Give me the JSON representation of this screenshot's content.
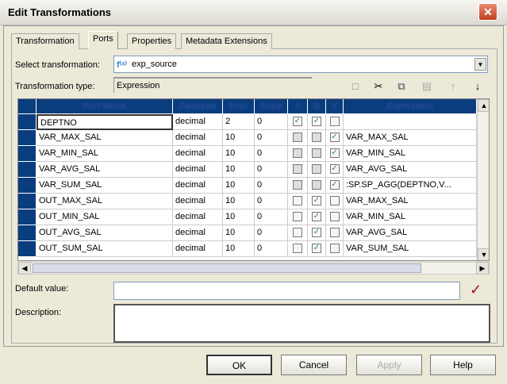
{
  "window": {
    "title": "Edit Transformations",
    "close_icon": "close-icon"
  },
  "tabs": [
    "Transformation",
    "Ports",
    "Properties",
    "Metadata Extensions"
  ],
  "active_tab": "Ports",
  "select_transformation": {
    "label": "Select transformation:",
    "value": "exp_source"
  },
  "transformation_type": {
    "label": "Transformation type:",
    "value": "Expression"
  },
  "toolbar": [
    "new-port-icon",
    "cut-icon",
    "copy-icon",
    "paste-icon",
    "move-up-icon",
    "move-down-icon"
  ],
  "grid": {
    "columns": [
      "Port Name",
      "Datatype",
      "Prec",
      "Scale",
      "I",
      "O",
      "V",
      "Expression"
    ],
    "rows": [
      {
        "name": "DEPTNO",
        "type": "decimal",
        "prec": "2",
        "scale": "0",
        "i": true,
        "o": true,
        "v": false,
        "expr": ""
      },
      {
        "name": "VAR_MAX_SAL",
        "type": "decimal",
        "prec": "10",
        "scale": "0",
        "i": false,
        "o": false,
        "v": true,
        "expr": "VAR_MAX_SAL"
      },
      {
        "name": "VAR_MIN_SAL",
        "type": "decimal",
        "prec": "10",
        "scale": "0",
        "i": false,
        "o": false,
        "v": true,
        "expr": "VAR_MIN_SAL"
      },
      {
        "name": "VAR_AVG_SAL",
        "type": "decimal",
        "prec": "10",
        "scale": "0",
        "i": false,
        "o": false,
        "v": true,
        "expr": "VAR_AVG_SAL"
      },
      {
        "name": "VAR_SUM_SAL",
        "type": "decimal",
        "prec": "10",
        "scale": "0",
        "i": false,
        "o": false,
        "v": true,
        "expr": ":SP.SP_AGG(DEPTNO,V..."
      },
      {
        "name": "OUT_MAX_SAL",
        "type": "decimal",
        "prec": "10",
        "scale": "0",
        "i": false,
        "o": true,
        "v": false,
        "expr": "VAR_MAX_SAL"
      },
      {
        "name": "OUT_MIN_SAL",
        "type": "decimal",
        "prec": "10",
        "scale": "0",
        "i": false,
        "o": true,
        "v": false,
        "expr": "VAR_MIN_SAL"
      },
      {
        "name": "OUT_AVG_SAL",
        "type": "decimal",
        "prec": "10",
        "scale": "0",
        "i": false,
        "o": true,
        "v": false,
        "expr": "VAR_AVG_SAL"
      },
      {
        "name": "OUT_SUM_SAL",
        "type": "decimal",
        "prec": "10",
        "scale": "0",
        "i": false,
        "o": true,
        "v": false,
        "expr": "VAR_SUM_SAL"
      }
    ]
  },
  "default_value": {
    "label": "Default value:",
    "value": ""
  },
  "description": {
    "label": "Description:",
    "value": ""
  },
  "buttons": {
    "ok": "OK",
    "cancel": "Cancel",
    "apply": "Apply",
    "help": "Help"
  }
}
